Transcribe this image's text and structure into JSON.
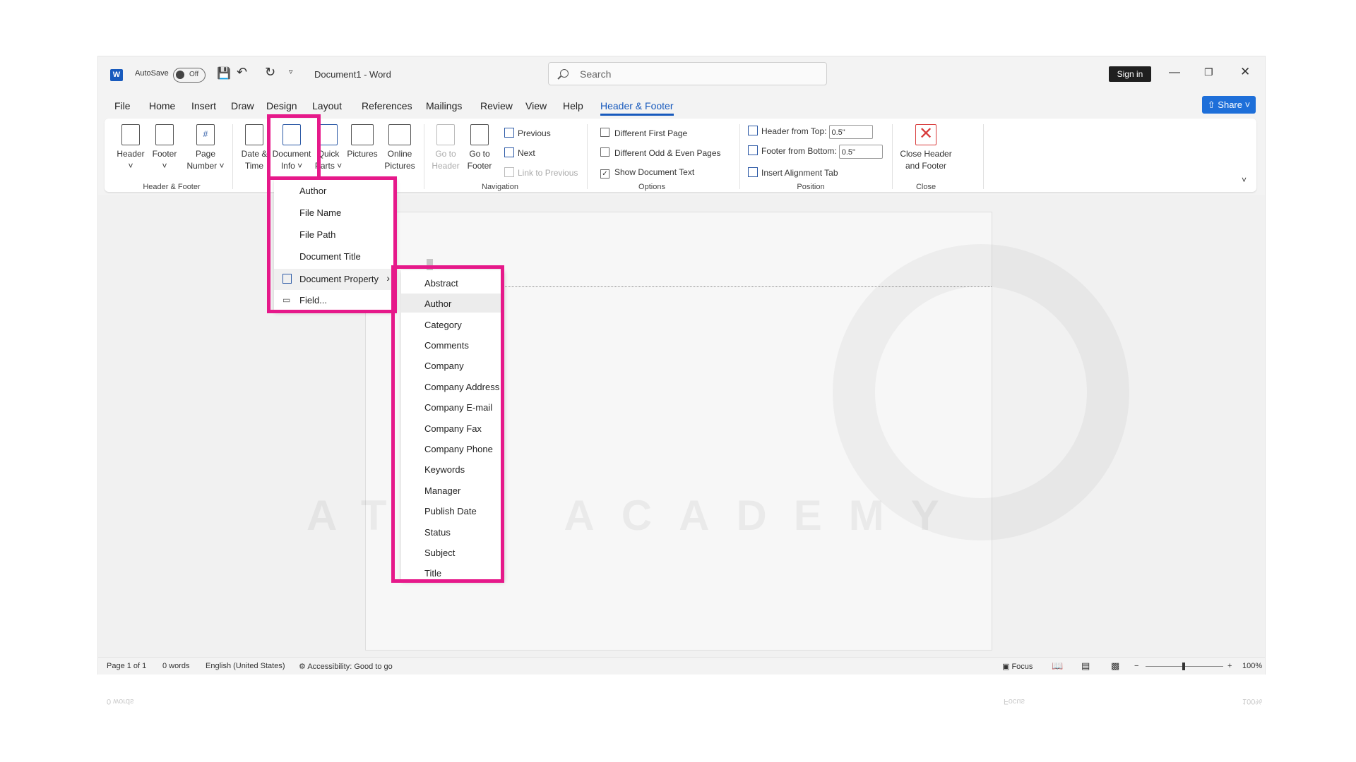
{
  "titlebar": {
    "autosave_label": "AutoSave",
    "autosave_state": "Off",
    "document_title": "Document1  -  Word",
    "search_placeholder": "Search",
    "signin_label": "Sign in"
  },
  "tabs": [
    "File",
    "Home",
    "Insert",
    "Draw",
    "Design",
    "Layout",
    "References",
    "Mailings",
    "Review",
    "View",
    "Help",
    "Header & Footer"
  ],
  "active_tab": "Header & Footer",
  "share_label": "Share",
  "ribbon": {
    "header_footer_group": {
      "label": "Header & Footer",
      "header": "Header",
      "footer": "Footer",
      "page_number_l1": "Page",
      "page_number_l2": "Number"
    },
    "insert_group": {
      "date_l1": "Date &",
      "date_l2": "Time",
      "docinfo_l1": "Document",
      "docinfo_l2": "Info",
      "quick_l1": "Quick",
      "quick_l2": "Parts",
      "pictures": "Pictures",
      "online_l1": "Online",
      "online_l2": "Pictures"
    },
    "navigation": {
      "label": "Navigation",
      "goto_header_l1": "Go to",
      "goto_header_l2": "Header",
      "goto_footer_l1": "Go to",
      "goto_footer_l2": "Footer",
      "previous": "Previous",
      "next": "Next",
      "link_previous": "Link to Previous"
    },
    "options": {
      "label": "Options",
      "diff_first": "Different First Page",
      "diff_odd_even": "Different Odd & Even Pages",
      "show_doc_text": "Show Document Text"
    },
    "position": {
      "label": "Position",
      "header_from_top": "Header from Top:",
      "header_value": "0.5\"",
      "footer_from_bottom": "Footer from Bottom:",
      "footer_value": "0.5\"",
      "insert_alignment": "Insert Alignment Tab"
    },
    "close": {
      "label": "Close",
      "btn_l1": "Close Header",
      "btn_l2": "and Footer"
    }
  },
  "docinfo_menu": [
    "Author",
    "File Name",
    "File Path",
    "Document Title",
    "Document Property",
    "Field..."
  ],
  "property_submenu": [
    "Abstract",
    "Author",
    "Category",
    "Comments",
    "Company",
    "Company Address",
    "Company E-mail",
    "Company Fax",
    "Company Phone",
    "Keywords",
    "Manager",
    "Publish Date",
    "Status",
    "Subject",
    "Title"
  ],
  "watermark": "ATRA ACADEMY",
  "status": {
    "page": "Page 1 of 1",
    "words": "0 words",
    "language": "English (United States)",
    "accessibility": "Accessibility: Good to go",
    "focus": "Focus",
    "zoom": "100%"
  },
  "colors": {
    "accent": "#185abd",
    "highlight": "#e6198a"
  }
}
